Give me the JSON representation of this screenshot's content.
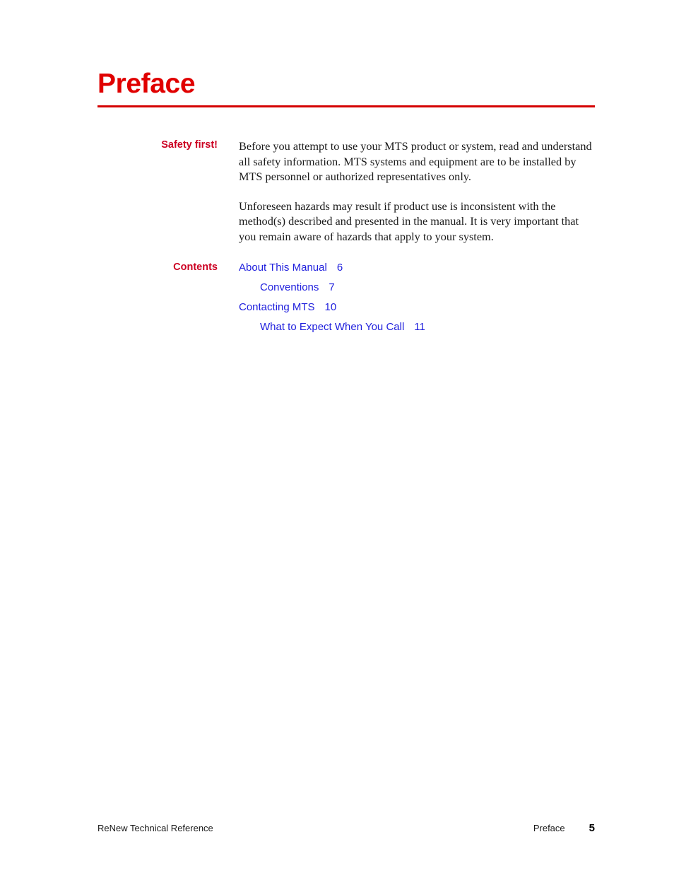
{
  "document": {
    "chapter_title": "Preface"
  },
  "sections": [
    {
      "label": "Safety first!",
      "paragraphs": [
        "Before you attempt to use your MTS product or system, read and understand all safety information. MTS systems and equipment are to be installed by MTS personnel or authorized representatives only.",
        "Unforeseen hazards may result if product use is inconsistent with the method(s) described and presented in the manual. It is very important that you remain aware of hazards that apply to your system."
      ]
    },
    {
      "label": "Contents"
    }
  ],
  "toc": [
    {
      "title": "About This Manual",
      "page": "6",
      "level": 1
    },
    {
      "title": "Conventions",
      "page": "7",
      "level": 2
    },
    {
      "title": "Contacting MTS",
      "page": "10",
      "level": 1
    },
    {
      "title": "What to Expect When You Call",
      "page": "11",
      "level": 2
    }
  ],
  "footer": {
    "left": "ReNew Technical Reference",
    "section": "Preface",
    "page_number": "5"
  },
  "colors": {
    "title_red": "#E00000",
    "rule_red": "#D40000",
    "label_red": "#CC0022",
    "link_blue": "#2020DD",
    "body_text": "#1a1a1a"
  }
}
